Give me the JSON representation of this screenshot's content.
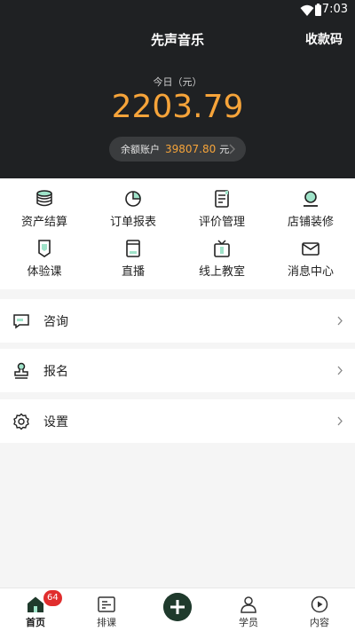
{
  "status": {
    "time": "7:03"
  },
  "header": {
    "title": "先声音乐",
    "qr_link": "收款码",
    "today_label": "今日（元）",
    "today_amount": "2203.79",
    "balance_label": "余额账户",
    "balance_value": "39807.80",
    "balance_unit": "元"
  },
  "grid": [
    {
      "label": "资产结算",
      "icon": "coin-stack-icon"
    },
    {
      "label": "订单报表",
      "icon": "pie-chart-icon"
    },
    {
      "label": "评价管理",
      "icon": "document-icon"
    },
    {
      "label": "店铺装修",
      "icon": "shop-icon"
    },
    {
      "label": "体验课",
      "icon": "badge-icon"
    },
    {
      "label": "直播",
      "icon": "live-icon"
    },
    {
      "label": "线上教室",
      "icon": "tv-icon"
    },
    {
      "label": "消息中心",
      "icon": "mail-icon"
    }
  ],
  "list": [
    {
      "label": "咨询",
      "icon": "chat-icon"
    },
    {
      "label": "报名",
      "icon": "stamp-icon"
    },
    {
      "label": "设置",
      "icon": "gear-icon"
    }
  ],
  "tabbar": {
    "home": "首页",
    "home_badge": "64",
    "schedule": "排课",
    "students": "学员",
    "content": "内容"
  },
  "colors": {
    "accent": "#f6a43a",
    "dark": "#1f2123",
    "highlight": "#9fe3c9",
    "badge": "#e02d2d"
  }
}
